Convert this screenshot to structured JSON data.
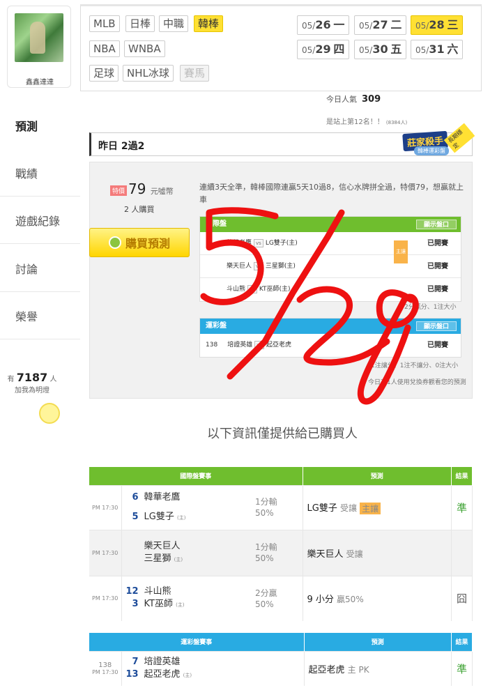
{
  "profile": {
    "username": "鑫鑫達達"
  },
  "nav": [
    {
      "label": "預測"
    },
    {
      "label": "戰績"
    },
    {
      "label": "遊戲紀錄"
    },
    {
      "label": "討論"
    },
    {
      "label": "榮譽"
    }
  ],
  "fans": {
    "prefix": "有",
    "count": "7187",
    "suffix": "人",
    "sub": "加我為明燈"
  },
  "leagues": [
    {
      "label": "MLB"
    },
    {
      "label": "日棒"
    },
    {
      "label": "中職"
    },
    {
      "label": "韓棒"
    },
    {
      "label": "NBA"
    },
    {
      "label": "WNBA"
    },
    {
      "label": "足球"
    },
    {
      "label": "NHL冰球"
    },
    {
      "label": "賽馬"
    }
  ],
  "dates": [
    {
      "md": "05/",
      "d": "26",
      "w": "一"
    },
    {
      "md": "05/",
      "d": "27",
      "w": "二"
    },
    {
      "md": "05/",
      "d": "28",
      "w": "三"
    },
    {
      "md": "05/",
      "d": "29",
      "w": "四"
    },
    {
      "md": "05/",
      "d": "30",
      "w": "五"
    },
    {
      "md": "05/",
      "d": "31",
      "w": "六"
    }
  ],
  "popularity": {
    "label": "今日人氣",
    "value": "309",
    "rank": "是站上第12名！！",
    "rank_small": "(8384人)"
  },
  "yesterday": "昨日 2過2",
  "badge": {
    "title": "莊家殺手",
    "sub": "韓棒運彩盤",
    "tag": "長期穩定"
  },
  "offer": {
    "tag": "特價",
    "price": "79",
    "unit": "元噓幣",
    "buyers": "2",
    "buyers_unit": "人購買",
    "buy_label": "購買預測",
    "note": "連續3天全準，韓棒國際連贏5天10過8，信心水牌拼全過，特價79，想贏就上車"
  },
  "preview": {
    "intl_header": "國際盤",
    "show_label": "顯示盤口",
    "rows": [
      {
        "away": "韓華老鷹",
        "vs": "vs",
        "home": "LG雙子(主)",
        "mark": "主讓",
        "status": "已開賽"
      },
      {
        "away": "樂天巨人",
        "vs": "vs",
        "home": "三星獅(主)",
        "mark": "",
        "status": "已開賽"
      },
      {
        "away": "斗山熊",
        "vs": "vs",
        "home": "KT巫師(主)",
        "mark": "",
        "status": "已開賽"
      }
    ],
    "intl_foot": "2分贏分、1注大小",
    "sport_header": "運彩盤",
    "sport_rows": [
      {
        "no": "138",
        "away": "培證英雄",
        "vs": "vs",
        "home": "起亞老虎",
        "status": "已開賽"
      }
    ],
    "sport_foot": "1注讓分、1注不讓分、0注大小",
    "use_note": "今日有1人使用兌換券觀看您的預測"
  },
  "info_title": "以下資訊僅提供給已購買人",
  "intl_table": {
    "headers": [
      "國際盤賽事",
      "預測",
      "結果"
    ],
    "rows": [
      {
        "time": "PM 17:30",
        "s1": "6",
        "t1": "韓華老鷹",
        "s2": "5",
        "t2": "LG雙子",
        "home": "主",
        "odds1": "1分輸",
        "odds2": "50%",
        "pred": "LG雙子",
        "pred_sub": "受讓",
        "mark": "主讓",
        "result": "準"
      },
      {
        "time": "PM 17:30",
        "s1": "",
        "t1": "樂天巨人",
        "s2": "",
        "t2": "三星獅",
        "home": "主",
        "odds1": "1分輸",
        "odds2": "50%",
        "pred": "樂天巨人",
        "pred_sub": "受讓",
        "mark": "",
        "result": ""
      },
      {
        "time": "PM 17:30",
        "s1": "12",
        "t1": "斗山熊",
        "s2": "3",
        "t2": "KT巫師",
        "home": "主",
        "odds1": "2分贏",
        "odds2": "50%",
        "pred": "9 小分",
        "pred_sub": "贏50%",
        "mark": "",
        "result": "囧"
      }
    ]
  },
  "sport_table": {
    "headers": [
      "運彩盤賽事",
      "預測",
      "結果"
    ],
    "rows": [
      {
        "no": "138",
        "time": "PM 17:30",
        "s1": "7",
        "t1": "培證英雄",
        "s2": "13",
        "t2": "起亞老虎",
        "home": "主",
        "pred": "起亞老虎",
        "pred_sub": "主 PK",
        "result": "準"
      }
    ]
  },
  "annotation": {
    "text": "5/28",
    "color": "#ee1111"
  },
  "colors": {
    "green": "#6fbe2e",
    "blue": "#29abe2",
    "yellow": "#ffe033"
  }
}
